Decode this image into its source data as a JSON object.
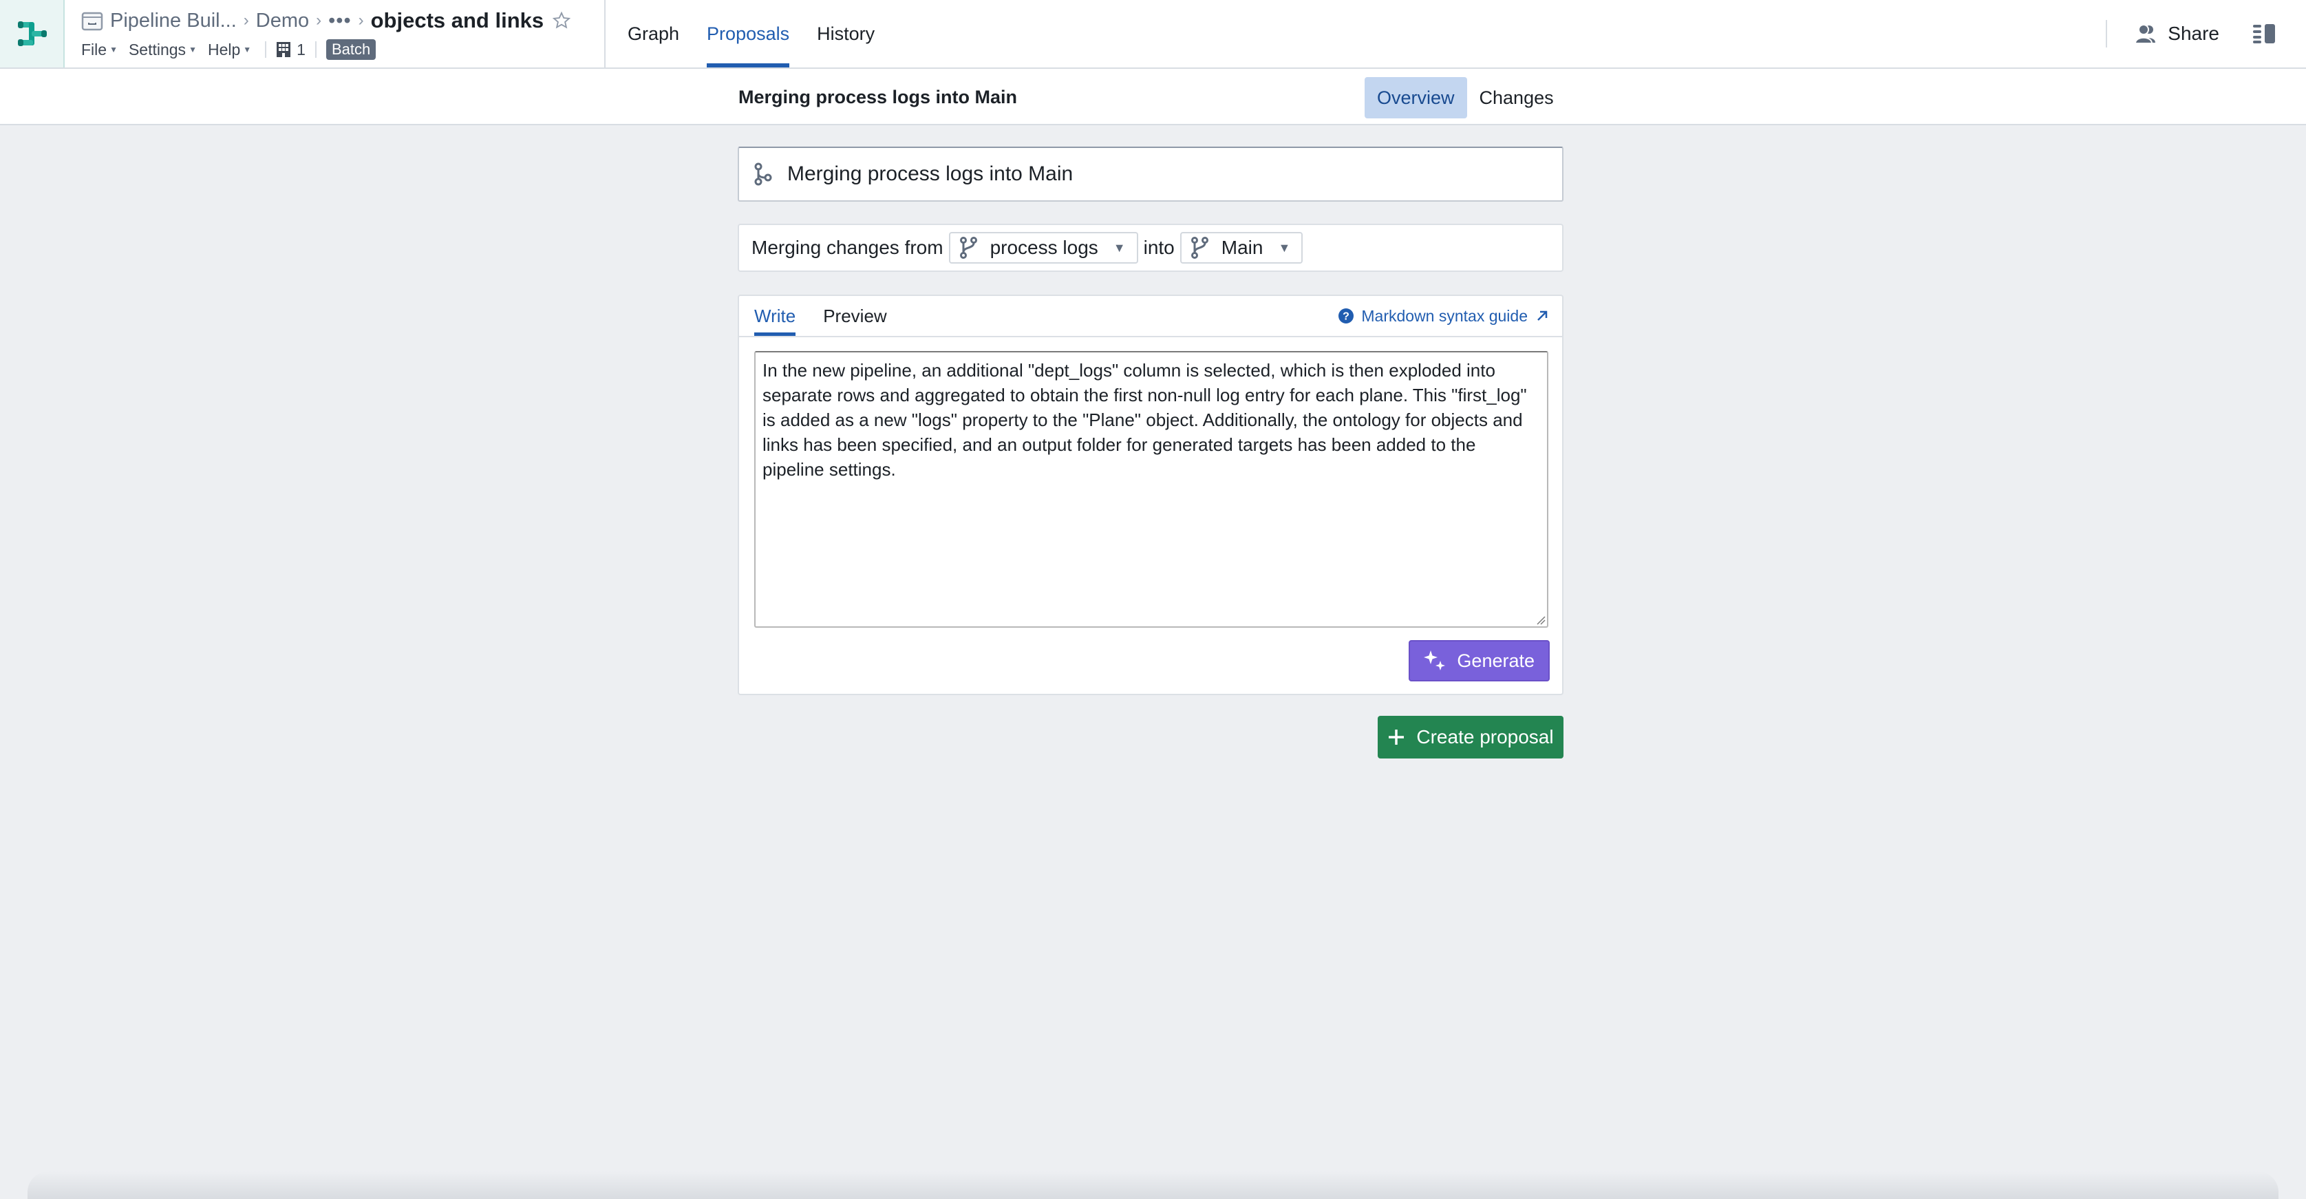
{
  "header": {
    "logo_icon": "pipeline-builder-logo",
    "breadcrumb": {
      "app_icon": "app-folder-icon",
      "app_name": "Pipeline Buil...",
      "folder": "Demo",
      "ellipsis": "•••",
      "title": "objects and links",
      "star_icon": "star-icon"
    },
    "menus": [
      {
        "label": "File"
      },
      {
        "label": "Settings"
      },
      {
        "label": "Help"
      }
    ],
    "building_count": "1",
    "mode_badge": "Batch",
    "tabs": [
      {
        "label": "Graph",
        "active": false
      },
      {
        "label": "Proposals",
        "active": true
      },
      {
        "label": "History",
        "active": false
      }
    ],
    "share_label": "Share",
    "colors": {
      "accent": "#215DB0",
      "logo": "#0F9F8F"
    }
  },
  "subheader": {
    "title": "Merging process logs into Main",
    "view_tabs": [
      {
        "label": "Overview",
        "active": true
      },
      {
        "label": "Changes",
        "active": false
      }
    ]
  },
  "proposal": {
    "title_value": "Merging process logs into Main",
    "merge": {
      "prefix": "Merging changes from",
      "source_branch": "process logs",
      "connector": "into",
      "target_branch": "Main"
    },
    "editor": {
      "tabs": [
        {
          "label": "Write",
          "active": true
        },
        {
          "label": "Preview",
          "active": false
        }
      ],
      "markdown_guide_label": "Markdown syntax guide",
      "description": "In the new pipeline, an additional \"dept_logs\" column is selected, which is then exploded into separate rows and aggregated to obtain the first non-null log entry for each plane. This \"first_log\" is added as a new \"logs\" property to the \"Plane\" object. Additionally, the ontology for objects and links has been specified, and an output folder for generated targets has been added to the pipeline settings.",
      "generate_label": "Generate",
      "generate_color": "#7961DB"
    },
    "create_label": "Create proposal",
    "create_color": "#238551"
  }
}
